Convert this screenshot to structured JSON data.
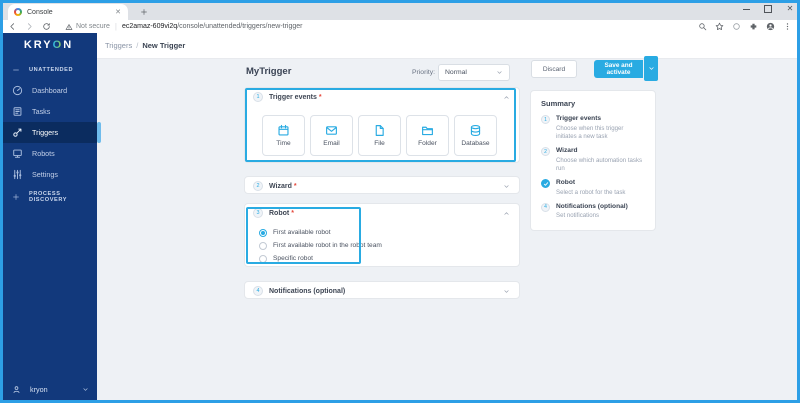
{
  "colors": {
    "accent": "#29ABE2",
    "sidebar_bg": "#12397C",
    "sidebar_active": "#0B2C5F",
    "frame": "#2D9FE6",
    "required_red": "#E5483C"
  },
  "browser": {
    "tab_title": "Console",
    "security_label": "Not secure",
    "url_host": "ec2amaz-609vi2q",
    "url_path": "/console/unattended/triggers/new-trigger"
  },
  "sidebar": {
    "logo_pre": "KRY",
    "logo_o": "O",
    "logo_post": "N",
    "group_label": "UNATTENDED",
    "items": [
      {
        "id": "dashboard",
        "label": "Dashboard",
        "icon": "dashboard-icon",
        "active": false
      },
      {
        "id": "tasks",
        "label": "Tasks",
        "icon": "tasks-icon",
        "active": false
      },
      {
        "id": "triggers",
        "label": "Triggers",
        "icon": "triggers-icon",
        "active": true
      },
      {
        "id": "robots",
        "label": "Robots",
        "icon": "robots-icon",
        "active": false
      },
      {
        "id": "settings",
        "label": "Settings",
        "icon": "settings-icon",
        "active": false
      }
    ],
    "footer_group_label": "PROCESS DISCOVERY",
    "user_name": "kryon"
  },
  "breadcrumb": {
    "parent": "Triggers",
    "separator": "/",
    "current": "New Trigger"
  },
  "toolbar": {
    "title": "MyTrigger",
    "priority_label": "Priority:",
    "priority_value": "Normal",
    "discard_label": "Discard",
    "save_label": "Save and activate"
  },
  "sections": {
    "trigger_events": {
      "step": "1",
      "title": "Trigger events",
      "required": "*",
      "expanded": true,
      "tiles": [
        {
          "label": "Time",
          "icon": "calendar-icon"
        },
        {
          "label": "Email",
          "icon": "email-icon"
        },
        {
          "label": "File",
          "icon": "file-icon"
        },
        {
          "label": "Folder",
          "icon": "folder-icon"
        },
        {
          "label": "Database",
          "icon": "database-icon"
        }
      ]
    },
    "wizard": {
      "step": "2",
      "title": "Wizard",
      "required": "*",
      "expanded": false
    },
    "robot": {
      "step": "3",
      "title": "Robot",
      "required": "*",
      "expanded": true,
      "options": [
        {
          "label": "First available robot",
          "selected": true
        },
        {
          "label": "First available robot in the robot team",
          "selected": false
        },
        {
          "label": "Specific robot",
          "selected": false
        }
      ]
    },
    "notifications": {
      "step": "4",
      "title": "Notifications (optional)",
      "required": "",
      "expanded": false
    }
  },
  "summary": {
    "title": "Summary",
    "items": [
      {
        "step": "1",
        "title": "Trigger events",
        "desc": "Choose when this trigger initiates a new task",
        "done": false
      },
      {
        "step": "2",
        "title": "Wizard",
        "desc": "Choose which automation tasks run",
        "done": false
      },
      {
        "step": "3",
        "title": "Robot",
        "desc": "Select a robot for the task",
        "done": true
      },
      {
        "step": "4",
        "title": "Notifications (optional)",
        "desc": "Set notifications",
        "done": false
      }
    ]
  }
}
